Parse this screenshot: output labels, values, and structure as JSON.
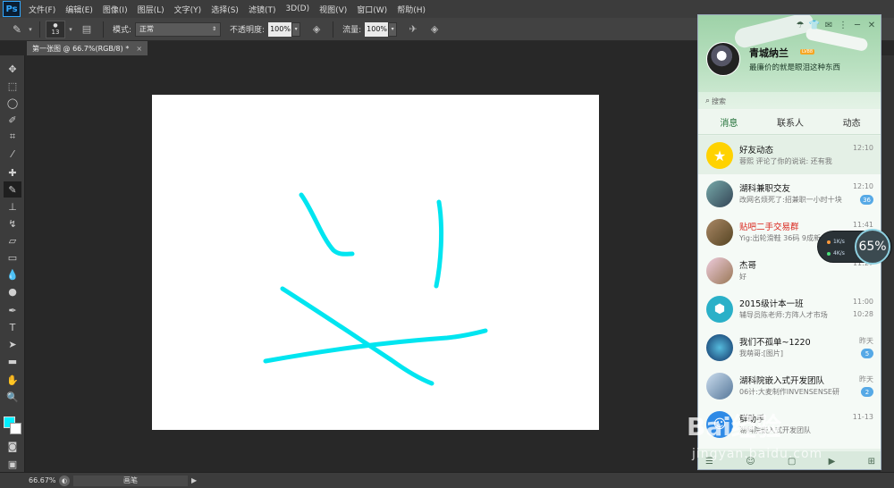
{
  "app": {
    "logo": "Ps"
  },
  "menubar": {
    "items": [
      "文件(F)",
      "编辑(E)",
      "图像(I)",
      "图层(L)",
      "文字(Y)",
      "选择(S)",
      "滤镜(T)",
      "3D(D)",
      "视图(V)",
      "窗口(W)",
      "帮助(H)"
    ]
  },
  "options": {
    "brush_size": "13",
    "mode_label": "模式:",
    "mode_value": "正常",
    "opacity_label": "不透明度:",
    "opacity_value": "100%",
    "flow_label": "流量:",
    "flow_value": "100%"
  },
  "document": {
    "tab_title": "第一张图 @ 66.7%(RGB/8) *",
    "tab_close": "×"
  },
  "status": {
    "zoom": "66.67%",
    "tool_name": "画笔"
  },
  "colors": {
    "foreground": "#00f0ff",
    "background": "#ffffff",
    "stroke": "#00e5f0"
  },
  "qq": {
    "user_name": "青城纳兰",
    "vip_badge": "LV88",
    "signature": "最廉价的就是眼泪这种东西",
    "search_placeholder": "搜索",
    "tabs": [
      "消息",
      "联系人",
      "动态"
    ],
    "conversations": [
      {
        "name": "好友动态",
        "preview": "蓉熙  评论了你的说说: 还有我",
        "time": "12:10",
        "badge": "",
        "avatar": "star",
        "red": false
      },
      {
        "name": "湖科兼职交友",
        "preview": "改网名烦死了:招兼职一小时十块",
        "time": "12:10",
        "badge": "36",
        "avatar": "group1",
        "red": false
      },
      {
        "name": "贴吧二手交易群",
        "preview": "Yig:出轮滑鞋 36码 9成新",
        "time": "11:41",
        "badge": "",
        "avatar": "group2",
        "red": true
      },
      {
        "name": "杰哥",
        "preview": "好",
        "time": "11:27",
        "badge": "",
        "avatar": "person",
        "red": false
      },
      {
        "name": "2015级计本一班",
        "preview": "辅导员陈老师:方阵人才市场",
        "time": "11:00",
        "mini": "10:28",
        "badge": "",
        "avatar": "cube",
        "red": false
      },
      {
        "name": "我们不孤单~1220",
        "preview": "我萌哥:[图片]",
        "time": "昨天",
        "badge": "5",
        "avatar": "earth",
        "red": false
      },
      {
        "name": "湖科院嵌入式开发团队",
        "preview": "06计:大麦制作INVENSENSE研",
        "time": "昨天",
        "badge": "2",
        "avatar": "hands",
        "red": false
      },
      {
        "name": "群助手",
        "preview": "湖科院嵌入式开发团队",
        "time": "11-13",
        "badge": "",
        "avatar": "helper",
        "red": false
      }
    ]
  },
  "speed_widget": {
    "up": "1K/s",
    "down": "4K/s",
    "percent": "65%"
  },
  "watermark": {
    "logo": "Bai经验",
    "url": "jingyan.baidu.com"
  }
}
